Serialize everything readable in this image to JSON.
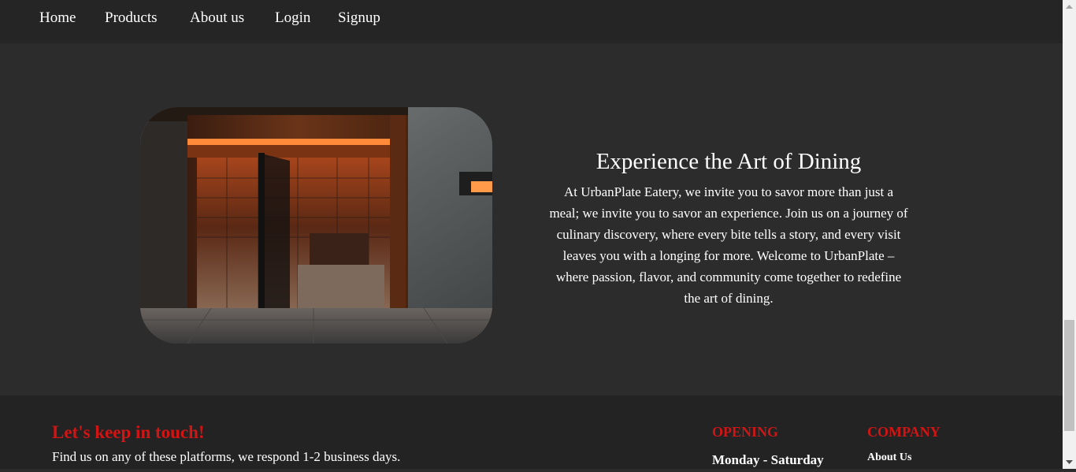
{
  "nav": {
    "items": [
      {
        "label": "Home"
      },
      {
        "label": "Products"
      },
      {
        "label": "About us"
      },
      {
        "label": "Login"
      },
      {
        "label": "Signup"
      }
    ]
  },
  "hero": {
    "title": "Experience the Art of Dining",
    "body": "At UrbanPlate Eatery, we invite you to savor more than just a meal; we invite you to savor an experience. Join us on a journey of culinary discovery, where every bite tells a story, and every visit leaves you with a longing for more. Welcome to UrbanPlate – where passion, flavor, and community come together to redefine the art of dining.",
    "image_alt": "restaurant entrance photo"
  },
  "footer": {
    "title": "Let's keep in touch!",
    "description": "Find us on any of these platforms, we respond 1-2 business days.",
    "opening": {
      "heading": "OPENING",
      "days": "Monday - Saturday"
    },
    "company": {
      "heading": "COMPANY",
      "links": [
        {
          "label": "About Us"
        }
      ]
    }
  },
  "colors": {
    "background": "#2c2c2c",
    "navbar": "#252525",
    "footer": "#232323",
    "accent_red": "#d11414",
    "text": "#ffffff"
  },
  "scrollbar": {
    "up_icon": "triangle-up-icon",
    "down_icon": "triangle-down-icon"
  }
}
